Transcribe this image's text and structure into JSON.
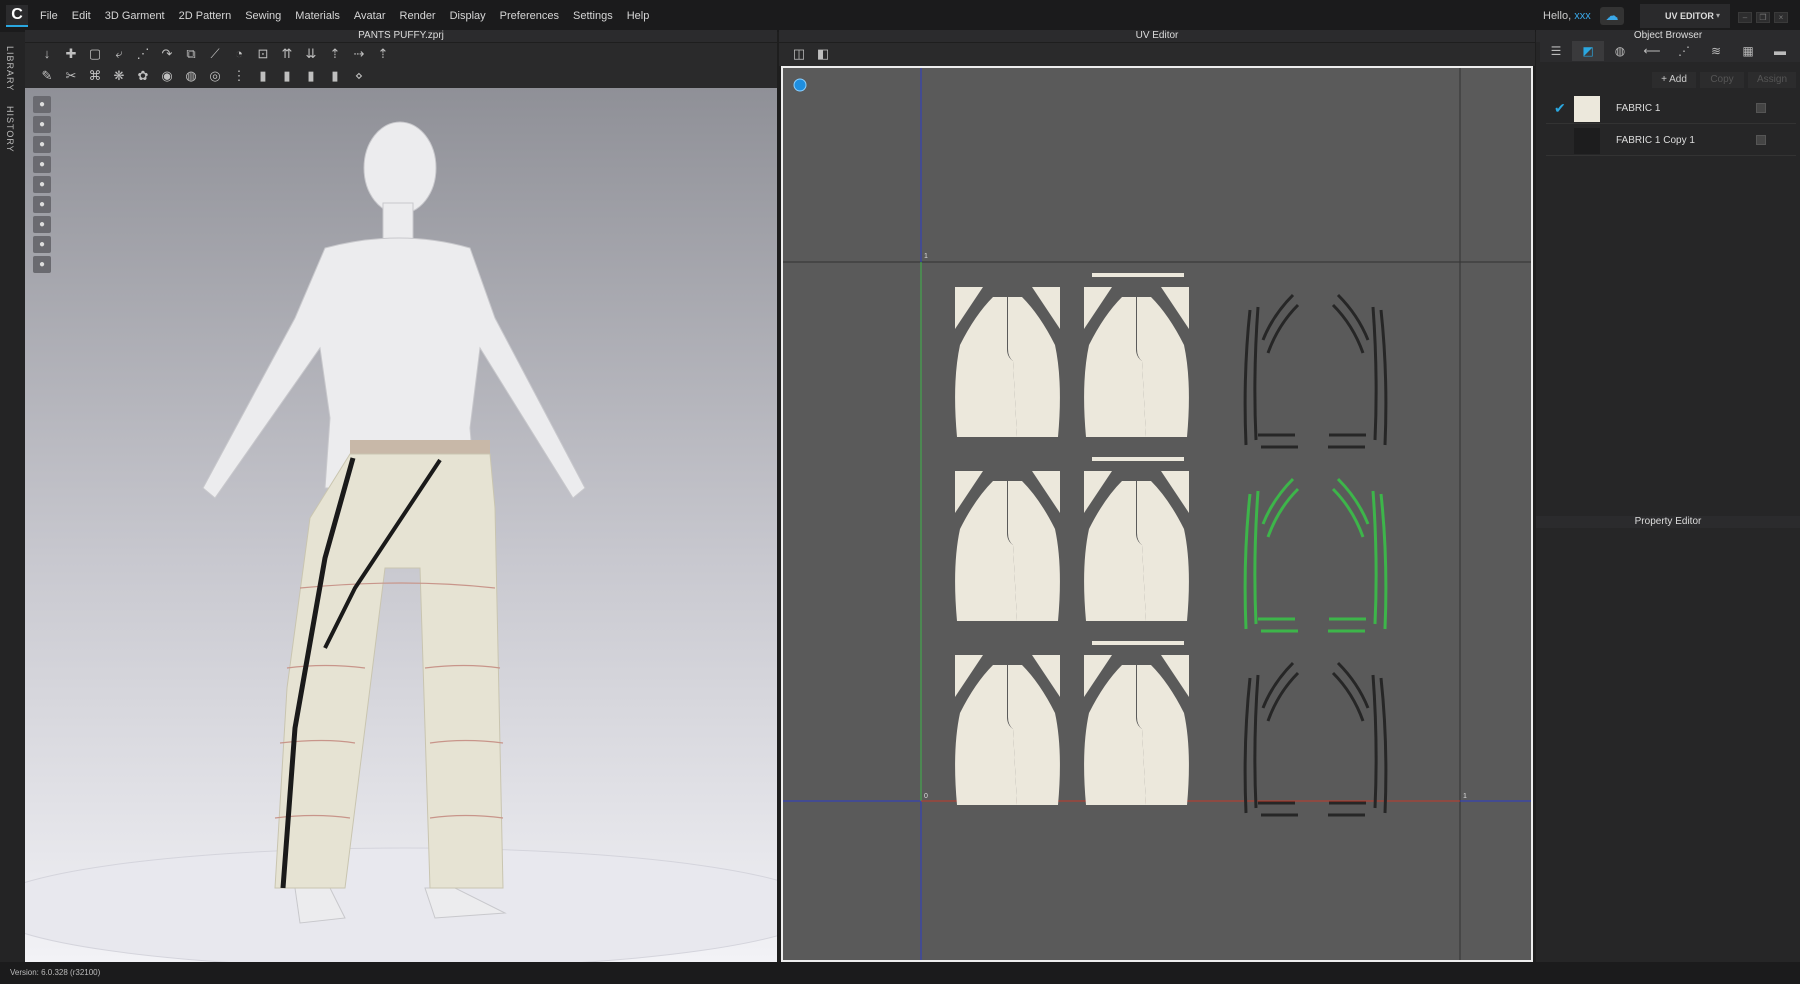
{
  "app": {
    "logo": "C",
    "menu": [
      "File",
      "Edit",
      "3D Garment",
      "2D Pattern",
      "Sewing",
      "Materials",
      "Avatar",
      "Render",
      "Display",
      "Preferences",
      "Settings",
      "Help"
    ],
    "greeting": "Hello,",
    "user": "xxx",
    "mode": "UV EDITOR",
    "mode_arrow": "▾"
  },
  "left_strip": {
    "tabs": [
      "LIBRARY",
      "HISTORY"
    ]
  },
  "viewport3d": {
    "title": "PANTS PUFFY.zprj",
    "toolbar_row1": [
      "↓",
      "✚",
      "▢",
      "⤶",
      "⋰",
      "↷",
      "⧉",
      "⟋",
      "◔",
      "⊡",
      "⇈",
      "⇊",
      "⇡",
      "⇢",
      "⇡"
    ],
    "toolbar_row2": [
      "✎",
      "✂",
      "⌘",
      "❋",
      "✿",
      "◉",
      "◍",
      "◎",
      "⋮",
      "▮",
      "▮",
      "▮",
      "▮",
      "⋄"
    ],
    "side_tools": [
      "●",
      "●",
      "●",
      "●",
      "●",
      "●",
      "●",
      "●",
      "●"
    ]
  },
  "uv_editor": {
    "title": "UV Editor",
    "toolbar": [
      "◫",
      "◧"
    ],
    "axis_labels": {
      "origin": "0",
      "u_one": "1",
      "v_one": "1"
    },
    "colors": {
      "fabric": "#ece8dc",
      "selected_outline": "#3db54a",
      "outline": "#262626",
      "u_axis": "#c0392b",
      "v_axis": "#3db54a",
      "grid_blue": "#2c3cc8"
    }
  },
  "object_browser": {
    "title": "Object Browser",
    "tabs": [
      "☰",
      "◩",
      "◍",
      "⟵",
      "⋰",
      "≋",
      "▦",
      "▬"
    ],
    "active_tab": 1,
    "buttons": {
      "add": "+ Add",
      "copy": "Copy",
      "assign": "Assign"
    },
    "fabrics": [
      {
        "name": "FABRIC 1",
        "color": "#ece8dc",
        "checked": true
      },
      {
        "name": "FABRIC 1 Copy 1",
        "color": "#1d1d1e",
        "checked": false
      }
    ]
  },
  "property_editor": {
    "title": "Property Editor"
  },
  "status": {
    "version": "Version: 6.0.328 (r32100)"
  }
}
